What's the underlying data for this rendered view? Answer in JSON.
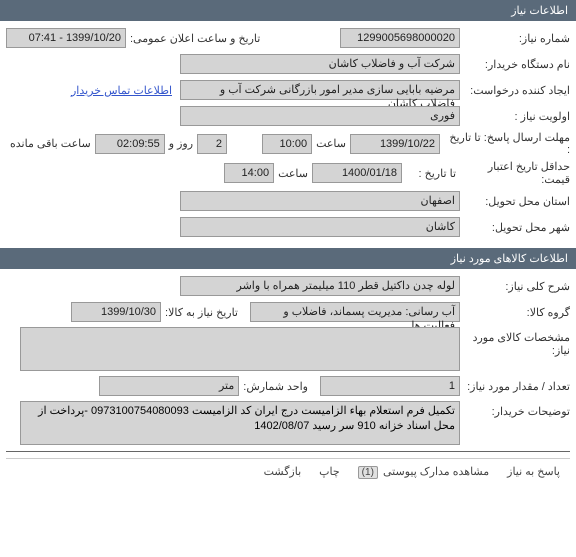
{
  "section1": {
    "title": "اطلاعات نیاز"
  },
  "need_number": {
    "label": "شماره نیاز:",
    "value": "1299005698000020"
  },
  "public_date": {
    "label": "تاریخ و ساعت اعلان عمومی:",
    "value": "1399/10/20 - 07:41"
  },
  "buyer_device": {
    "label": "نام دستگاه خریدار:",
    "value": "شرکت آب و فاضلاب کاشان"
  },
  "creator": {
    "label": "ایجاد کننده درخواست:",
    "value": "مرضیه بابایی سازی مدیر امور بازرگانی شرکت آب و فاضلاب کاشان"
  },
  "contact_link": "اطلاعات تماس خریدار",
  "priority": {
    "label": "اولویت نیاز :",
    "value": "فوری"
  },
  "deadline": {
    "label": "مهلت ارسال پاسخ:  تا تاریخ :",
    "date": "1399/10/22",
    "time_label": "ساعت",
    "time": "10:00",
    "days": "2",
    "days_label": "روز و",
    "remaining": "02:09:55",
    "remaining_label": "ساعت باقی مانده"
  },
  "min_validity": {
    "label": "حداقل تاریخ اعتبار قیمت:",
    "sublabel": "تا تاریخ :",
    "date": "1400/01/18",
    "time_label": "ساعت",
    "time": "14:00"
  },
  "delivery_province": {
    "label": "استان محل تحویل:",
    "value": "اصفهان"
  },
  "delivery_city": {
    "label": "شهر محل تحویل:",
    "value": "کاشان"
  },
  "section2": {
    "title": "اطلاعات کالاهای مورد نیاز"
  },
  "general_desc": {
    "label": "شرح کلی نیاز:",
    "value": "لوله چدن داکتیل قطر 110 میلیمتر همراه با واشر"
  },
  "goods_group": {
    "label": "گروه کالا:",
    "value": "آب رسانی: مدیریت پسماند، فاضلاب و فعالیت ها"
  },
  "need_by_date": {
    "label": "تاریخ نیاز به کالا:",
    "value": "1399/10/30"
  },
  "goods_spec": {
    "label": "مشخصات کالای مورد نیاز:",
    "value": ""
  },
  "quantity": {
    "label": "تعداد / مقدار مورد نیاز:",
    "value": "1"
  },
  "unit": {
    "label": "واحد شمارش:",
    "value": "متر"
  },
  "buyer_notes": {
    "label": "توضیحات خریدار:",
    "value": "تکمیل فرم استعلام بهاء الزامیست     درج ایران کد الزامیست   0973100754080093 -پرداخت از محل اسناد خزانه 910 سر رسید 1402/08/07"
  },
  "footer": {
    "respond": "پاسخ به نیاز",
    "attachments": "مشاهده مدارک پیوستی",
    "attachments_count": "(1)",
    "print": "چاپ",
    "back": "بازگشت"
  }
}
